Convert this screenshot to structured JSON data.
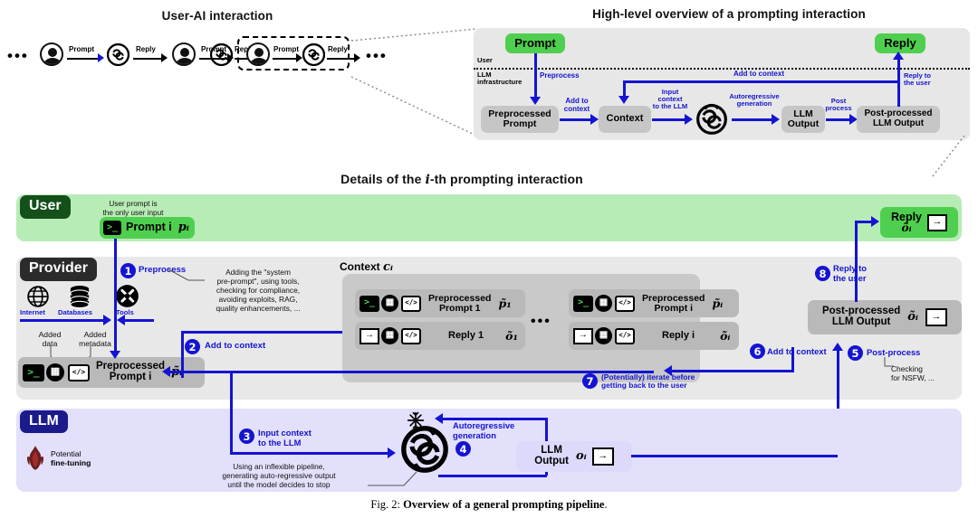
{
  "figure": {
    "caption_prefix": "Fig. 2: ",
    "caption_bold": "Overview of a general prompting pipeline",
    "caption_suffix": "."
  },
  "panel_top_left": {
    "title": "User-AI interaction",
    "ellipsis_left": "•••",
    "ellipsis_right": "•••",
    "edges": [
      {
        "label": "Prompt"
      },
      {
        "label": "Reply"
      },
      {
        "label": "Prompt"
      },
      {
        "label": "Reply"
      },
      {
        "label": "Prompt"
      },
      {
        "label": "Reply"
      }
    ],
    "user_icon": "user-avatar-icon",
    "ai_icon": "openai-logo-icon",
    "highlight_note": "dashed selection around third interaction"
  },
  "panel_top_right": {
    "title": "High-level overview of a prompting interaction",
    "lane_user_label": "User",
    "lane_llm_label": "LLM\ninfrastructure",
    "lane_llm_label_line1": "LLM",
    "lane_llm_label_line2": "infrastructure",
    "prompt_box": "Prompt",
    "reply_box": "Reply",
    "boxes": [
      {
        "id": "preprocessed-prompt",
        "line1": "Preprocessed",
        "line2": "Prompt"
      },
      {
        "id": "context",
        "line1": "Context",
        "line2": ""
      },
      {
        "id": "llm-output",
        "line1": "LLM",
        "line2": "Output"
      },
      {
        "id": "post-processed-llm-output",
        "line1": "Post-processed",
        "line2": "LLM Output"
      }
    ],
    "arrow_labels": {
      "preprocess": "Preprocess",
      "add_to_context_1_l1": "Add to",
      "add_to_context_1_l2": "context",
      "input_context_l1": "Input",
      "input_context_l2": "context",
      "input_context_l3": "to the LLM",
      "autoregressive_l1": "Autoregressive",
      "autoregressive_l2": "generation",
      "post_process_l1": "Post",
      "post_process_l2": "process",
      "add_to_context_2": "Add to context",
      "reply_to_user_l1": "Reply to",
      "reply_to_user_l2": "the user"
    }
  },
  "panel_main": {
    "title_part1": "Details of the ",
    "title_italic": "i",
    "title_part2": "-th prompting interaction",
    "lanes": {
      "user": "User",
      "provider": "Provider",
      "llm": "LLM"
    },
    "user_row": {
      "note_l1": "User prompt is",
      "note_l2": "the only user input",
      "prompt_box_label": "Prompt i",
      "prompt_box_symbol": "pᵢ",
      "reply_box_label": "Reply",
      "reply_box_symbol": "õᵢ",
      "terminal_icon": "terminal-prompt-icon",
      "export_icon": "export-arrow-icon"
    },
    "provider_row": {
      "sources": [
        {
          "icon": "globe-icon",
          "label": "Internet"
        },
        {
          "icon": "database-icon",
          "label": "Databases"
        },
        {
          "icon": "tools-icon",
          "label": "Tools"
        }
      ],
      "added_data_l1": "Added",
      "added_data_l2": "data",
      "added_meta_l1": "Added",
      "added_meta_l2": "metadata",
      "preprocessed_box_l1": "Preprocessed",
      "preprocessed_box_l2": "Prompt i",
      "preprocessed_box_symbol": "p̃ᵢ",
      "preprocess_note_l1": "Adding the \"system",
      "preprocess_note_l2": "pre-prompt\", using tools,",
      "preprocess_note_l3": "checking for compliance,",
      "preprocess_note_l4": "avoiding exploits, RAG,",
      "preprocess_note_l5": "quality enhancements, ...",
      "postprocess_note_l1": "Checking",
      "postprocess_note_l2": "for NSFW, ...",
      "post_box_l1": "Post-processed",
      "post_box_l2": "LLM Output",
      "post_box_symbol": "õᵢ"
    },
    "context": {
      "title": "Context",
      "title_symbol": "cᵢ",
      "ellipsis": "•••",
      "items": [
        {
          "label_l1": "Preprocessed",
          "label_l2": "Prompt 1",
          "symbol": "p̃₁",
          "kind": "prompt"
        },
        {
          "label_l1": "Preprocessed",
          "label_l2": "Prompt i",
          "symbol": "p̃ᵢ",
          "kind": "prompt"
        },
        {
          "label_l1": "Reply 1",
          "label_l2": "",
          "symbol": "õ₁",
          "kind": "reply"
        },
        {
          "label_l1": "Reply i",
          "label_l2": "",
          "symbol": "õᵢ",
          "kind": "reply"
        }
      ]
    },
    "llm_row": {
      "snowflake_icon": "snowflake-frozen-icon",
      "fire_icon": "fire-finetune-icon",
      "potential_l1": "Potential",
      "potential_l2": "fine-tuning",
      "openai_icon": "openai-logo-icon",
      "note_l1": "Using an inflexible pipeline,",
      "note_l2": "generating auto-regressive output",
      "note_l3": "until the model decides to stop",
      "output_box_l1": "LLM",
      "output_box_l2": "Output",
      "output_box_symbol": "oᵢ"
    },
    "steps": [
      {
        "num": "❶",
        "label": "Preprocess"
      },
      {
        "num": "❷",
        "label": "Add to context"
      },
      {
        "num": "❸",
        "label_l1": "Input context",
        "label_l2": "to the LLM"
      },
      {
        "num": "❹",
        "label_l1": "Autoregressive",
        "label_l2": "generation"
      },
      {
        "num": "❺",
        "label": "Post-process"
      },
      {
        "num": "❻",
        "label": "Add to context"
      },
      {
        "num": "❼",
        "label_l1": "(Potentially) iterate before",
        "label_l2": "getting back to the user"
      },
      {
        "num": "❽",
        "label_l1": "Reply to",
        "label_l2": "the user"
      }
    ]
  },
  "colors": {
    "blue": "#1414d2",
    "green_box": "#4fcf4f",
    "lane_user": "#b8ecb6",
    "lane_provider": "#e8e8e8",
    "lane_llm": "#e3e0fb",
    "grey_box": "#c6c6c6",
    "tag_user": "#14501a",
    "tag_provider": "#2b2b2b",
    "tag_llm": "#1b1b8c"
  }
}
